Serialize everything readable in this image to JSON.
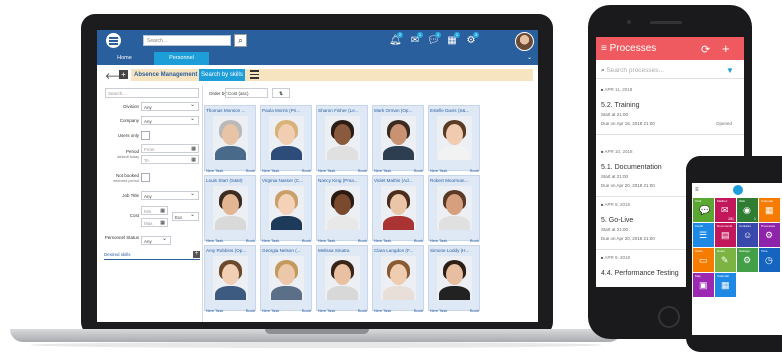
{
  "app": {
    "search_placeholder": "Search...",
    "tabs": [
      "Home",
      "Personnel"
    ],
    "breadcrumb": "Absence Management",
    "breadcrumb_action": "Search by skills",
    "badges": [
      "2",
      "1",
      "1",
      "1",
      "3"
    ]
  },
  "filters": {
    "search_placeholder": "Search...",
    "division_label": "Division",
    "division_value": "Any",
    "company_label": "Company",
    "company_value": "Any",
    "users_only_label": "Users only",
    "period_label": "Period",
    "period_sub": "default today",
    "from_placeholder": "From",
    "to_placeholder": "To",
    "not_booked_label": "Not booked",
    "not_booked_sub": "selected period",
    "job_title_label": "Job Title",
    "job_title_value": "Any",
    "cost_label": "Cost",
    "min_placeholder": "Min",
    "max_placeholder": "Max",
    "currency_value": "Eur.",
    "personnel_status_label": "Personnel Status",
    "personnel_status_value": "Any",
    "desired_skills_label": "Desired skills"
  },
  "grid": {
    "order_label": "Order by:",
    "order_value": "Cost (asc)",
    "order_dir": "⇅",
    "new_task_label": "New Task",
    "book_label": "Book",
    "cards": [
      "Thomas Monson ...",
      "Paula Morris (Pri...",
      "Sharon Fisher (Le...",
      "Mark Orman (Op...",
      "Estelle Davis (S&...",
      "Louis Starr (S&M)",
      "Virginia Nasser (C...",
      "Nancy King (Prsa...",
      "Violet Mathis (Ad...",
      "Robert Moorman...",
      "Amy Robbins (Op...",
      "Georgia Nelson (...",
      "Melissa Sinatra",
      "Clara Langdon (F...",
      "Simone Loddy (H..."
    ]
  },
  "phone1": {
    "title": "Processes",
    "search_placeholder": "Search processes...",
    "items": [
      {
        "date": "APR 11, 2018",
        "title": "5.2. Training",
        "start": "Start at 21:00",
        "due": "Due on Apr 16, 2018  21:00",
        "status": "Opened"
      },
      {
        "date": "APR 10, 2018",
        "title": "5.1. Documentation",
        "start": "Start at 21:00",
        "due": "Due on Apr 20, 2018  21:00",
        "status": ""
      },
      {
        "date": "APR 9, 2018",
        "title": "5. Go-Live",
        "start": "Start at 21:00",
        "due": "Due on Apr 20, 2018  21:00",
        "status": ""
      },
      {
        "date": "APR 9, 2018",
        "title": "4.4. Performance Testing",
        "start": "",
        "due": "",
        "status": ""
      }
    ]
  },
  "phone2": {
    "tiles": [
      {
        "label": "Chat",
        "color": "#5aa832",
        "icon": "💬",
        "count": ""
      },
      {
        "label": "Mailbox",
        "color": "#c2185b",
        "icon": "✉",
        "count": "281"
      },
      {
        "label": "Web",
        "color": "#2e7d32",
        "icon": "◉",
        "count": "1"
      },
      {
        "label": "Calendar",
        "color": "#f57c00",
        "icon": "▦",
        "count": ""
      },
      {
        "label": "Cards",
        "color": "#1e88e5",
        "icon": "☰",
        "count": ""
      },
      {
        "label": "Documents",
        "color": "#c2185b",
        "icon": "▤",
        "count": ""
      },
      {
        "label": "Contacts",
        "color": "#3949ab",
        "icon": "☺",
        "count": ""
      },
      {
        "label": "Processes",
        "color": "#8e24aa",
        "icon": "⚙",
        "count": ""
      },
      {
        "label": "Tasks",
        "color": "#f57c00",
        "icon": "▭",
        "count": ""
      },
      {
        "label": "Notes",
        "color": "#7cb342",
        "icon": "✎",
        "count": ""
      },
      {
        "label": "Settings",
        "color": "#43a047",
        "icon": "⚙",
        "count": ""
      },
      {
        "label": "Time",
        "color": "#1565c0",
        "icon": "◷",
        "count": ""
      },
      {
        "label": "Map",
        "color": "#9c27b0",
        "icon": "▣",
        "count": ""
      },
      {
        "label": "Calendar",
        "color": "#1e88e5",
        "icon": "▦",
        "count": ""
      }
    ]
  }
}
